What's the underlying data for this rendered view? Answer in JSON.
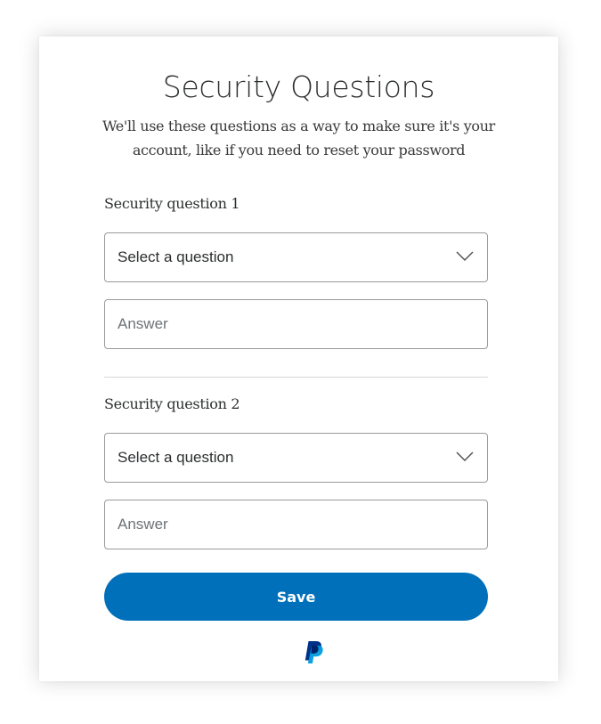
{
  "page": {
    "title": "Security Questions",
    "subtitle_line1": "We'll use these questions as a way to make sure it's your",
    "subtitle_line2": "account, like if you need to reset your password"
  },
  "question1": {
    "label": "Security question 1",
    "select_value": "Select a question",
    "answer_placeholder": "Answer",
    "answer_value": ""
  },
  "question2": {
    "label": "Security question 2",
    "select_value": "Select a question",
    "answer_placeholder": "Answer",
    "answer_value": ""
  },
  "actions": {
    "save_label": "Save"
  },
  "icons": {
    "dropdown": "chevron-down-icon",
    "logo": "paypal-logo"
  },
  "colors": {
    "primary": "#0070ba",
    "logo_dark": "#003087",
    "logo_light": "#009cde",
    "text": "#2c2e2f",
    "border": "#9a9a9a",
    "placeholder": "#6c7378"
  }
}
